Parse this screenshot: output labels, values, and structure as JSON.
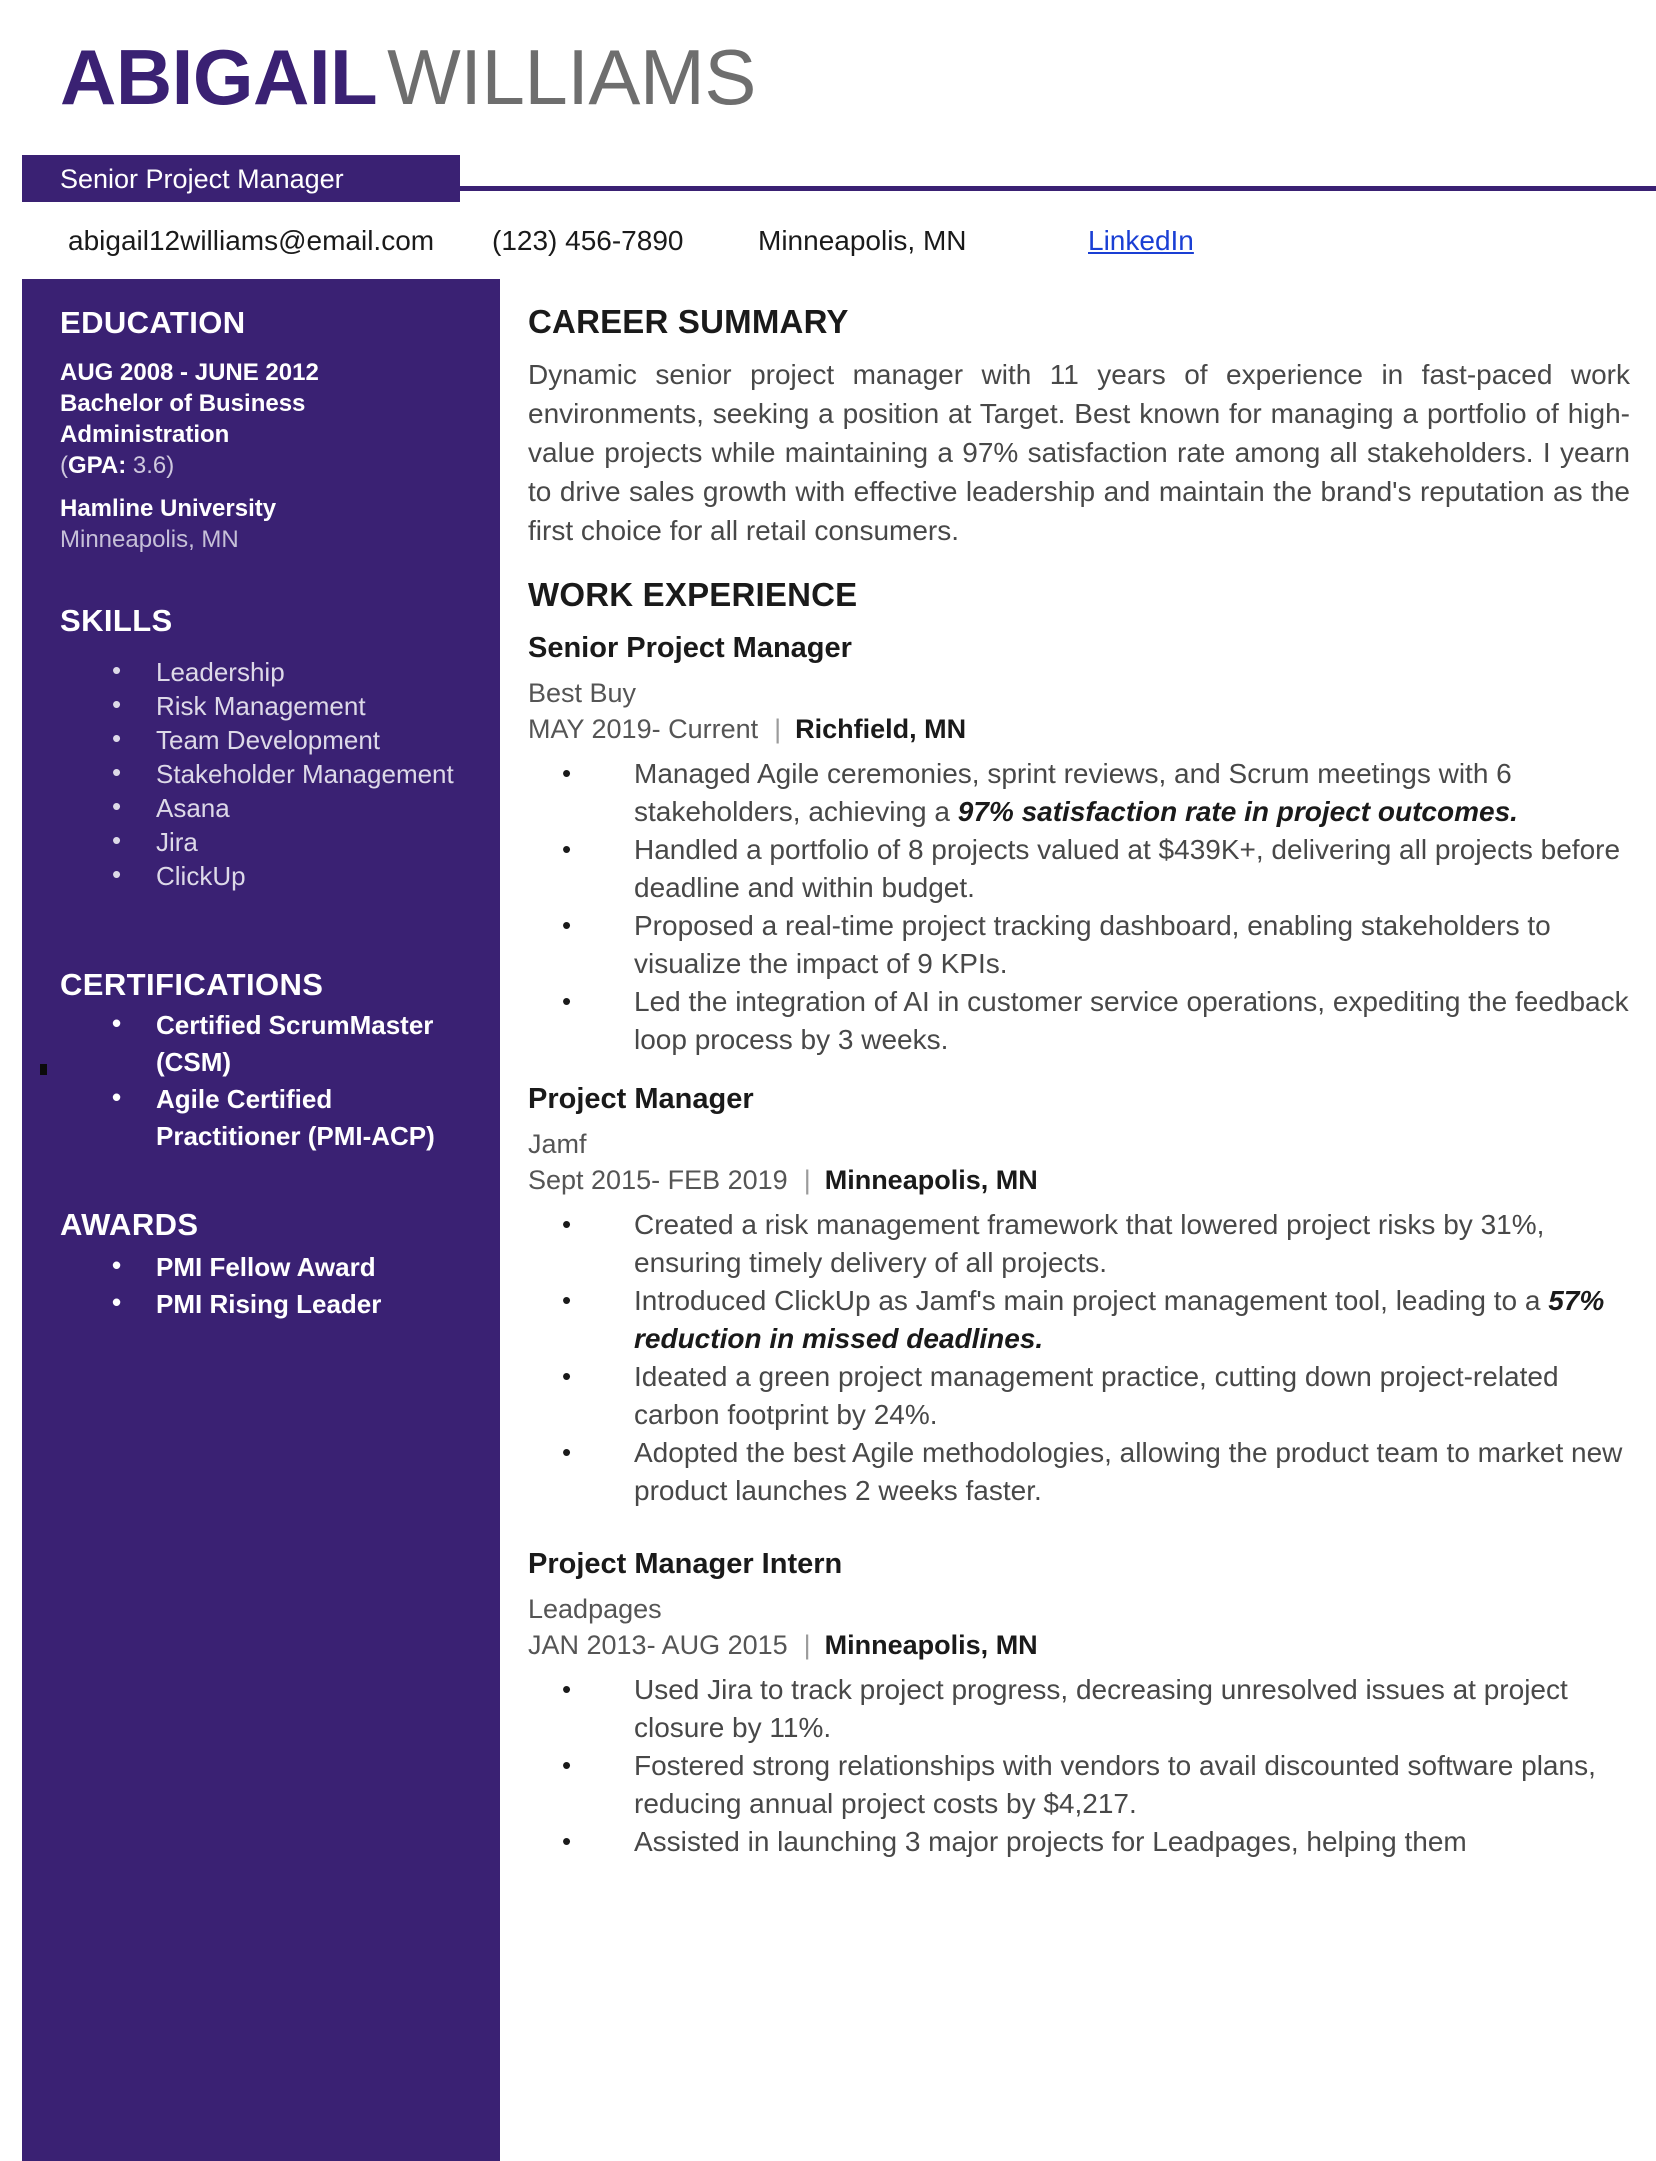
{
  "header": {
    "first_name": "ABIGAIL",
    "last_name": "WILLIAMS",
    "job_title": "Senior Project Manager",
    "accent_color": "#3A2173",
    "name_last_color": "#6E6E6E"
  },
  "contact": {
    "email": "abigail12williams@email.com",
    "phone": "(123) 456-7890",
    "location": "Minneapolis, MN",
    "link_label": "LinkedIn",
    "link_color": "#1A3FD4"
  },
  "sidebar": {
    "education": {
      "heading": "EDUCATION",
      "dates": "AUG 2008 - JUNE 2012",
      "degree": "Bachelor of Business Administration",
      "gpa_label": "GPA:",
      "gpa_value": "3.6",
      "school": "Hamline University",
      "school_location": "Minneapolis, MN"
    },
    "skills": {
      "heading": "SKILLS",
      "items": [
        "Leadership",
        "Risk Management",
        "Team Development",
        "Stakeholder Management",
        "Asana",
        "Jira",
        "ClickUp"
      ]
    },
    "certifications": {
      "heading": "CERTIFICATIONS",
      "items": [
        "Certified ScrumMaster (CSM)",
        "Agile Certified Practitioner (PMI-ACP)"
      ]
    },
    "awards": {
      "heading": "AWARDS",
      "items": [
        "PMI Fellow Award",
        "PMI Rising Leader"
      ]
    }
  },
  "main": {
    "career_summary": {
      "heading": "CAREER SUMMARY",
      "text": "Dynamic senior project manager with 11 years of experience in fast-paced work environments, seeking a position at Target. Best known for managing a portfolio of high-value projects while maintaining a 97% satisfaction rate among all stakeholders. I yearn to drive sales growth with effective leadership and maintain the brand's reputation as the first choice for all retail consumers."
    },
    "work_experience": {
      "heading": "WORK EXPERIENCE",
      "jobs": [
        {
          "title": "Senior Project Manager",
          "company": "Best Buy",
          "dates": "MAY 2019- Current",
          "separator": "|",
          "location": "Richfield, MN",
          "bullets": [
            {
              "pre": "Managed Agile ceremonies, sprint reviews, and Scrum meetings with 6 stakeholders, achieving a ",
              "bold": "97% satisfaction rate in project outcomes.",
              "post": ""
            },
            {
              "pre": "Handled a portfolio of 8 projects valued at $439K+, delivering all projects before deadline and within budget.",
              "bold": "",
              "post": ""
            },
            {
              "pre": "Proposed a real-time project tracking dashboard, enabling stakeholders to visualize the impact of 9 KPIs.",
              "bold": "",
              "post": ""
            },
            {
              "pre": "Led the integration of AI in customer service operations, expediting the feedback loop process by 3 weeks.",
              "bold": "",
              "post": ""
            }
          ]
        },
        {
          "title": "Project Manager",
          "company": "Jamf",
          "dates": "Sept 2015- FEB 2019",
          "separator": "|",
          "location": "Minneapolis, MN",
          "bullets": [
            {
              "pre": "Created a risk management framework that lowered project risks by 31%, ensuring timely delivery of all projects.",
              "bold": "",
              "post": ""
            },
            {
              "pre": "Introduced ClickUp as Jamf's main project management tool, leading to a ",
              "bold": "57% reduction in missed deadlines.",
              "post": ""
            },
            {
              "pre": "Ideated a green project management practice, cutting down project-related carbon footprint by 24%.",
              "bold": "",
              "post": ""
            },
            {
              "pre": "Adopted the best Agile methodologies, allowing the product team to market new product launches 2 weeks faster.",
              "bold": "",
              "post": ""
            }
          ]
        },
        {
          "title": "Project Manager Intern",
          "company": "Leadpages",
          "dates": "JAN 2013- AUG 2015",
          "separator": "|",
          "location": "Minneapolis, MN",
          "bullets": [
            {
              "pre": "Used Jira to track project progress, decreasing unresolved issues at project closure by 11%.",
              "bold": "",
              "post": ""
            },
            {
              "pre": "Fostered strong relationships with vendors to avail discounted software plans, reducing annual project costs by $4,217.",
              "bold": "",
              "post": ""
            },
            {
              "pre": "Assisted in launching 3 major projects for Leadpages, helping them",
              "bold": "",
              "post": ""
            }
          ]
        }
      ]
    }
  }
}
